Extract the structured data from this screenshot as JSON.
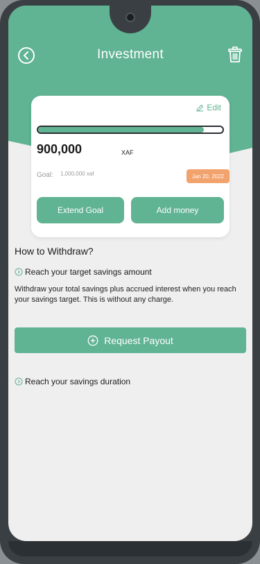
{
  "header": {
    "title": "Investment"
  },
  "card": {
    "edit_label": "Edit",
    "progress": 0.9,
    "amount": "900,000",
    "currency": "XAF",
    "goal_label": "Goal:",
    "goal_value": "1,000,000 xaf",
    "due_date": "Jan 20, 2022",
    "extend_label": "Extend Goal",
    "add_label": "Add money"
  },
  "withdraw": {
    "title": "How to Withdraw?",
    "step1": "Reach your target savings amount",
    "step1_desc": "Withdraw your total savings plus accrued interest when you reach your savings target. This is without any charge.",
    "payout_label": "Request Payout",
    "step2": "Reach your savings duration"
  },
  "colors": {
    "accent": "#60b393",
    "badge": "#f2a26d",
    "background": "#efefef"
  },
  "icons": {
    "back": "back-icon",
    "trash": "trash-icon",
    "edit": "pencil-icon",
    "step": "chevron-circle-icon",
    "payout": "plus-circle-icon"
  }
}
